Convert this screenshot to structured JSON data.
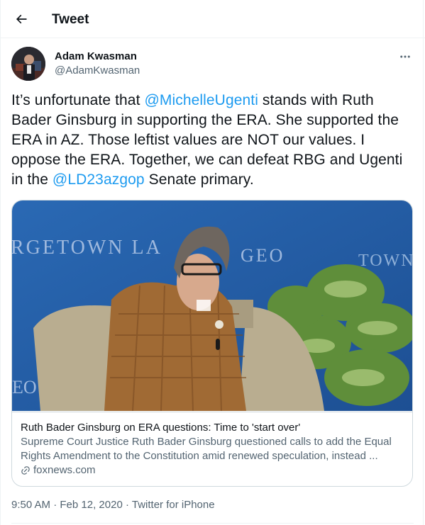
{
  "header": {
    "title": "Tweet",
    "back_icon": "arrow-left-icon"
  },
  "author": {
    "name": "Adam Kwasman",
    "handle": "@AdamKwasman",
    "more_icon": "more-horizontal-icon"
  },
  "tweet": {
    "segments": [
      {
        "text": "It’s unfortunate that ",
        "mention": false
      },
      {
        "text": "@MichelleUgenti",
        "mention": true
      },
      {
        "text": " stands with Ruth Bader Ginsburg in supporting the ERA. She supported the ERA in AZ. Those leftist values are NOT our values. I oppose the ERA. Together, we can defeat RBG and Ugenti in the ",
        "mention": false
      },
      {
        "text": "@LD23azgop",
        "mention": true
      },
      {
        "text": " Senate primary.",
        "mention": false
      }
    ]
  },
  "card": {
    "image_text_left": "RGETOWN LA",
    "image_text_right": "GEO",
    "image_text_right2": "TOWN",
    "image_text_bottom": "EO",
    "title": "Ruth Bader Ginsburg on ERA questions: Time to 'start over'",
    "description": "Supreme Court Justice Ruth Bader Ginsburg questioned calls to add the Equal Rights Amendment to the Constitution amid renewed speculation, instead ...",
    "domain": "foxnews.com",
    "link_icon": "link-icon"
  },
  "meta": {
    "time": "9:50 AM",
    "separator": " · ",
    "date": "Feb 12, 2020",
    "source": "Twitter for iPhone"
  },
  "colors": {
    "accent": "#1d9bf0",
    "secondary_text": "#536471",
    "border": "#cfd9de"
  }
}
